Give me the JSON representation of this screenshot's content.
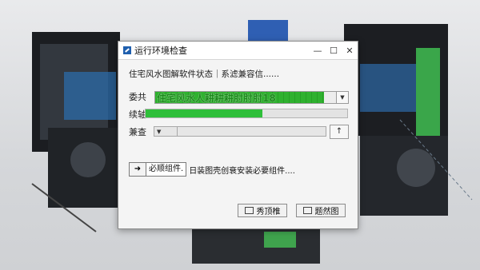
{
  "dialog": {
    "title": "运行环境检查",
    "minimize": "—",
    "maximize": "☐",
    "close": "✕",
    "heading": "住宅风水图解软件状态｜系滤兼容信......"
  },
  "row1": {
    "label": "委共",
    "bar_text": "住宅风水人耕耕耕肘肘肘18",
    "progress": 0.93,
    "dropdown_glyph": "▼"
  },
  "row2": {
    "label": "续轴.",
    "progress": 0.58
  },
  "row3": {
    "label": "兼查",
    "select_glyph": "▼",
    "up_glyph": "↑"
  },
  "extension": {
    "arrow": "➜",
    "label": "必顺组件.",
    "text": "日装图壳创衰安装必要组件...."
  },
  "buttons": {
    "primary_label": "秀顶椎",
    "secondary_label": "题然图"
  },
  "colors": {
    "accent_green": "#2fb12f",
    "window_bg": "#f4f4f4"
  }
}
